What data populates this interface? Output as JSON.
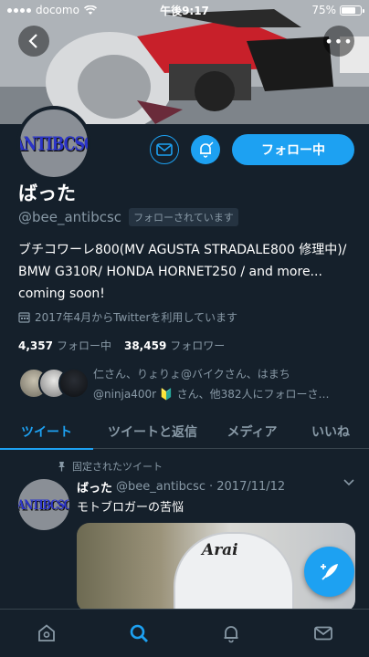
{
  "statusbar": {
    "carrier": "docomo",
    "time": "午後9:17",
    "battery": "75%",
    "battery_level": 0.75
  },
  "profile": {
    "avatar_text": "ANTIBCSC",
    "name": "ばった",
    "handle": "@bee_antibcsc",
    "follows_you": "フォローされています",
    "follow_button": "フォロー中",
    "bio": "ブチコワーレ800(MV AGUSTA STRADALE800 修理中)/ BMW G310R/ HONDA HORNET250 / and more... coming soon!",
    "joined": "2017年4月からTwitterを利用しています",
    "following_count": "4,357",
    "following_label": "フォロー中",
    "followers_count": "38,459",
    "followers_label": "フォロワー",
    "followed_by_line1": "仁さん、りょりょ@バイクさん、はまち",
    "followed_by_line2": "@ninja400r 🔰 さん、他382人にフォローさ…"
  },
  "tabs": [
    {
      "label": "ツイート",
      "active": true
    },
    {
      "label": "ツイートと返信",
      "active": false
    },
    {
      "label": "メディア",
      "active": false
    },
    {
      "label": "いいね",
      "active": false
    }
  ],
  "tweet": {
    "pinned_label": "固定されたツイート",
    "author_name": "ばった",
    "author_handle": "@bee_antibcsc",
    "date": "· 2017/11/12",
    "text": "モトブロガーの苦悩",
    "media_brand": "Arai"
  },
  "nav": [
    "home-icon",
    "search-icon",
    "notifications-icon",
    "messages-icon"
  ],
  "colors": {
    "background": "#15202b",
    "accent": "#1da1f2",
    "muted": "#8899a6"
  }
}
